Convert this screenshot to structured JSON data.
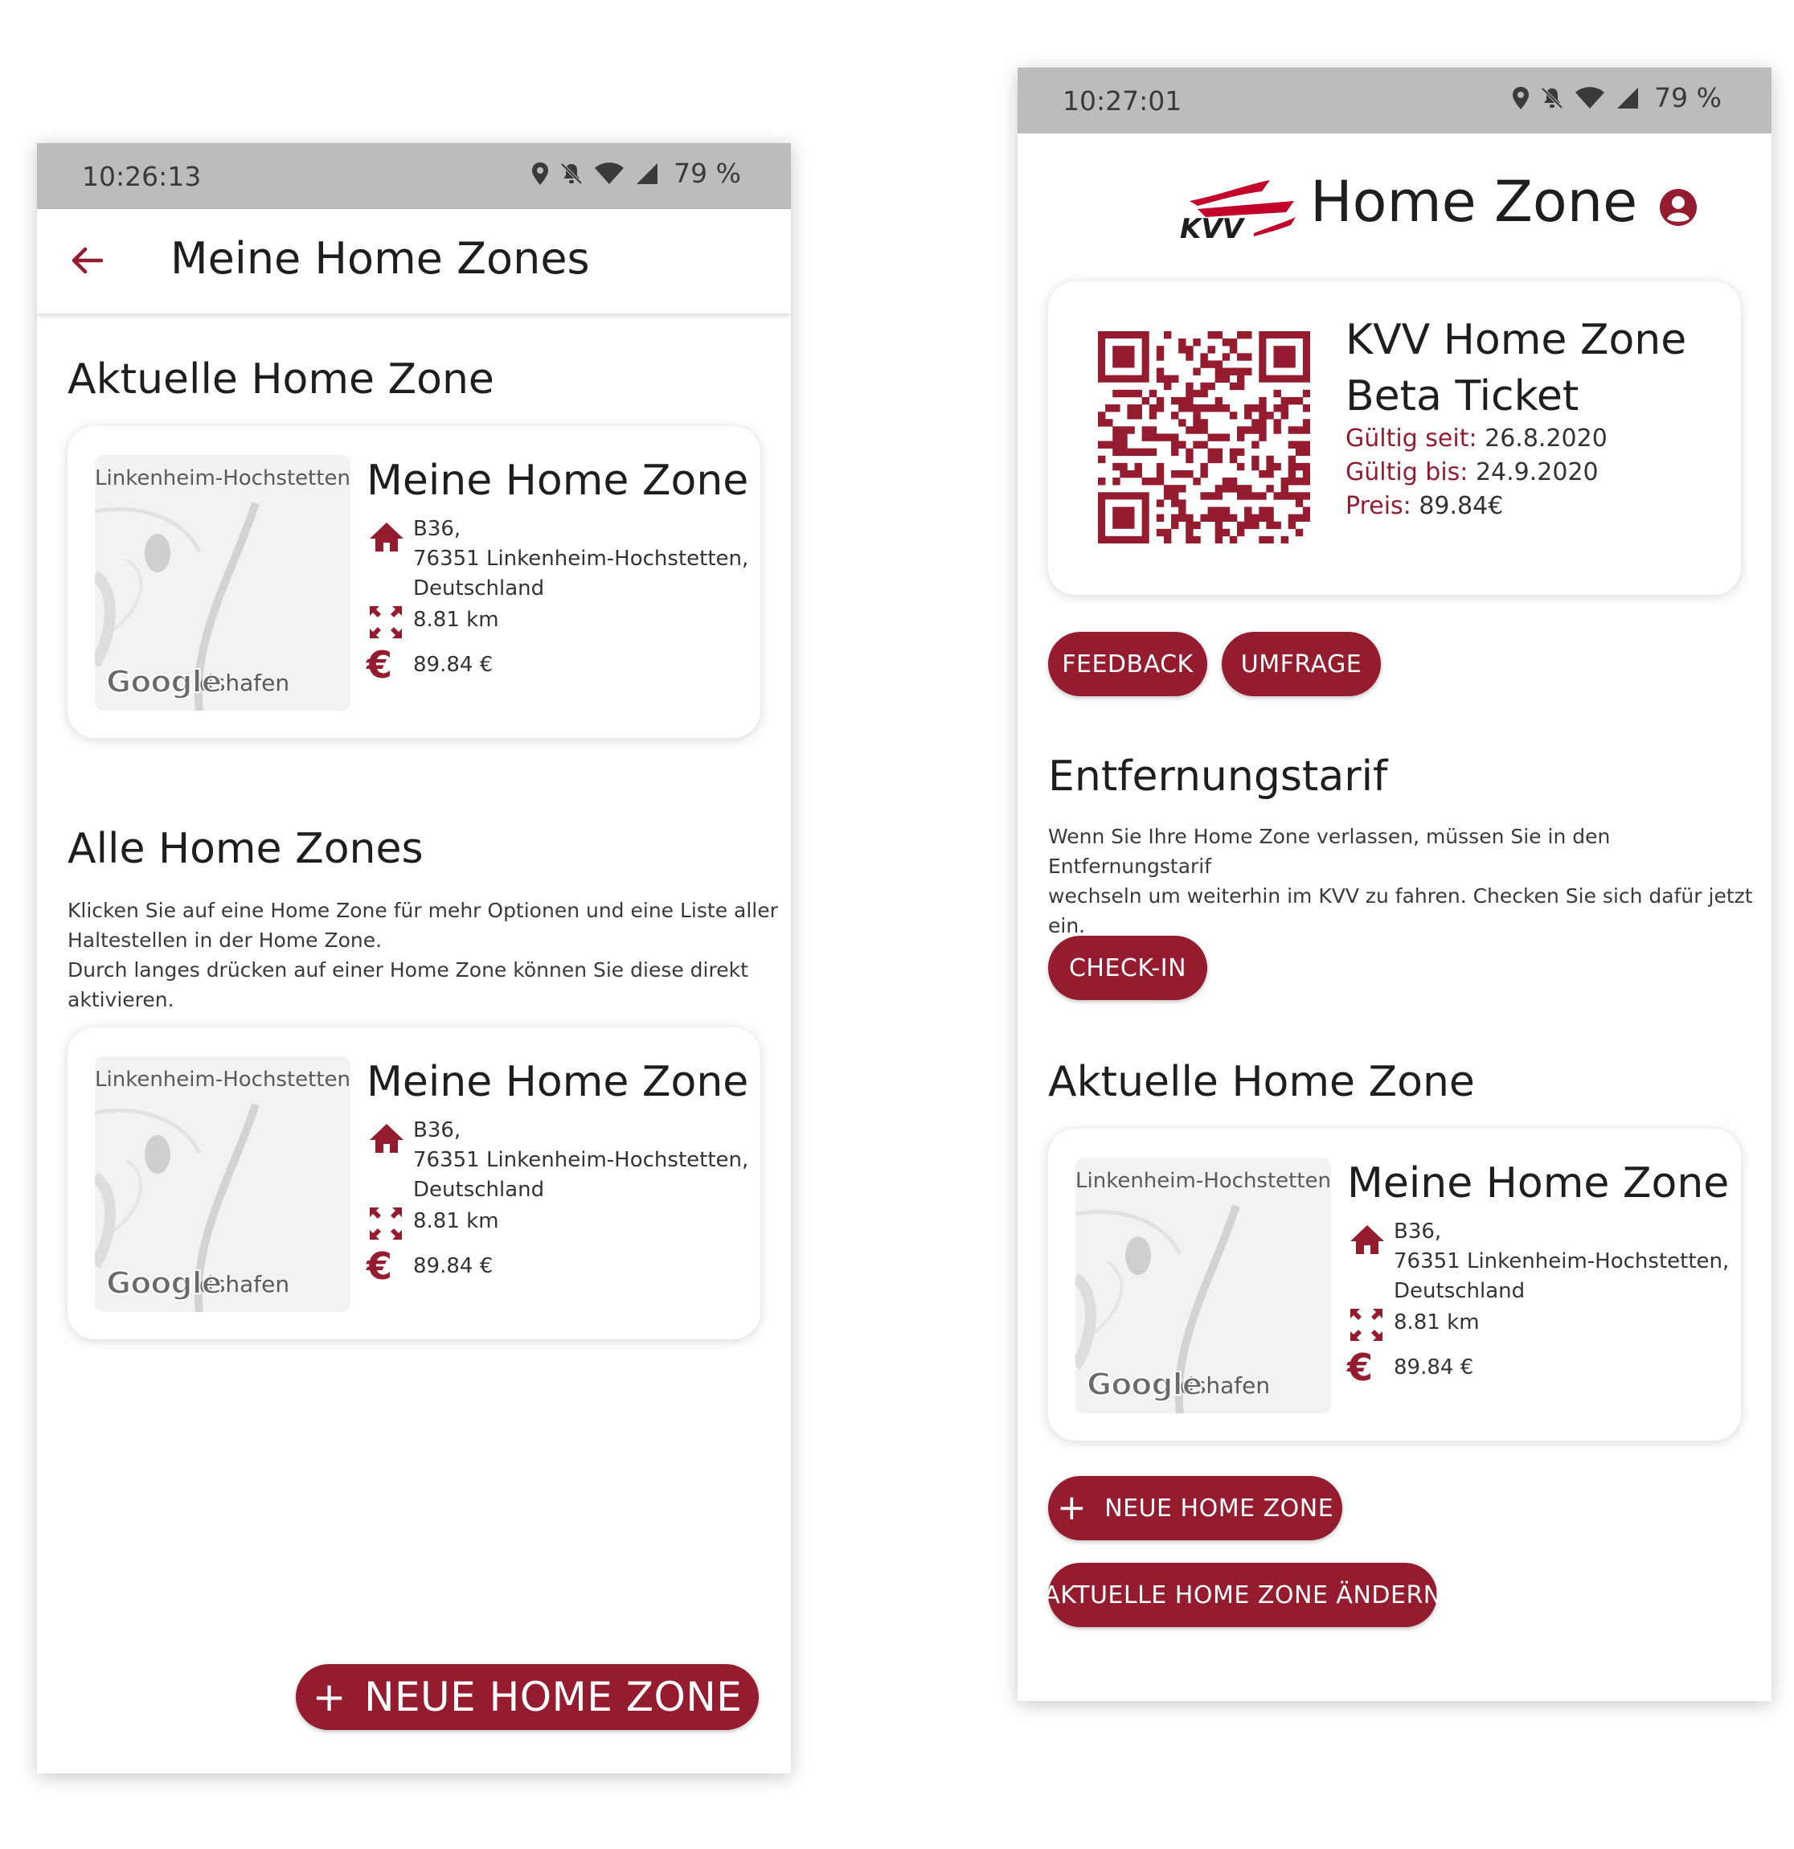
{
  "left": {
    "status": {
      "time": "10:26:13",
      "battery": "79 %"
    },
    "appbar": {
      "title": "Meine Home Zones"
    },
    "current_heading": "Aktuelle Home Zone",
    "current_zone": {
      "map_city": "Linkenheim-Hochstetten",
      "map_bottom": "dshafen",
      "map_logo": "Google",
      "name": "Meine Home Zone",
      "address_1": "B36,",
      "address_2": "76351 Linkenheim-Hochstetten,",
      "address_3": "Deutschland",
      "distance": "8.81 km",
      "price": "89.84 €"
    },
    "all_heading": "Alle Home Zones",
    "all_text_1": "Klicken Sie auf eine Home Zone für mehr Optionen und eine Liste aller",
    "all_text_2": "Haltestellen in der Home Zone.",
    "all_text_3": "Durch langes drücken auf einer Home Zone können Sie diese direkt",
    "all_text_4": "aktivieren.",
    "zone_item": {
      "map_city": "Linkenheim-Hochstetten",
      "map_bottom": "dshafen",
      "map_logo": "Google",
      "name": "Meine Home Zone",
      "address_1": "B36,",
      "address_2": "76351 Linkenheim-Hochstetten,",
      "address_3": "Deutschland",
      "distance": "8.81 km",
      "price": "89.84 €"
    },
    "fab_label": "NEUE HOME ZONE",
    "fab_plus": "+"
  },
  "right": {
    "status": {
      "time": "10:27:01",
      "battery": "79 %"
    },
    "header": {
      "logo_text": "KVV",
      "title": "Home Zone"
    },
    "ticket": {
      "name_1": "KVV Home Zone",
      "name_2": "Beta Ticket",
      "valid_from_label": "Gültig seit:",
      "valid_from": "26.8.2020",
      "valid_to_label": "Gültig bis:",
      "valid_to": "24.9.2020",
      "price_label": "Preis:",
      "price": "89.84€"
    },
    "feedback_label": "FEEDBACK",
    "survey_label": "UMFRAGE",
    "distance_heading": "Entfernungstarif",
    "distance_text_1": "Wenn Sie Ihre Home Zone verlassen, müssen Sie in den Entfernungstarif",
    "distance_text_2": "wechseln um weiterhin im KVV zu fahren. Checken Sie sich dafür jetzt",
    "distance_text_3": "ein.",
    "checkin_label": "CHECK-IN",
    "current_heading": "Aktuelle Home Zone",
    "current_zone": {
      "map_city": "Linkenheim-Hochstetten",
      "map_bottom": "dshafen",
      "map_logo": "Google",
      "name": "Meine Home Zone",
      "address_1": "B36,",
      "address_2": "76351 Linkenheim-Hochstetten,",
      "address_3": "Deutschland",
      "distance": "8.81 km",
      "price": "89.84 €"
    },
    "new_zone_label": "NEUE HOME ZONE",
    "new_zone_plus": "+",
    "change_zone_label": "AKTUELLE HOME ZONE ÄNDERN"
  },
  "euro_symbol": "€",
  "colors": {
    "accent": "#951b2f",
    "statusbar": "#bcbcbc",
    "map": "#f2f2f2"
  }
}
